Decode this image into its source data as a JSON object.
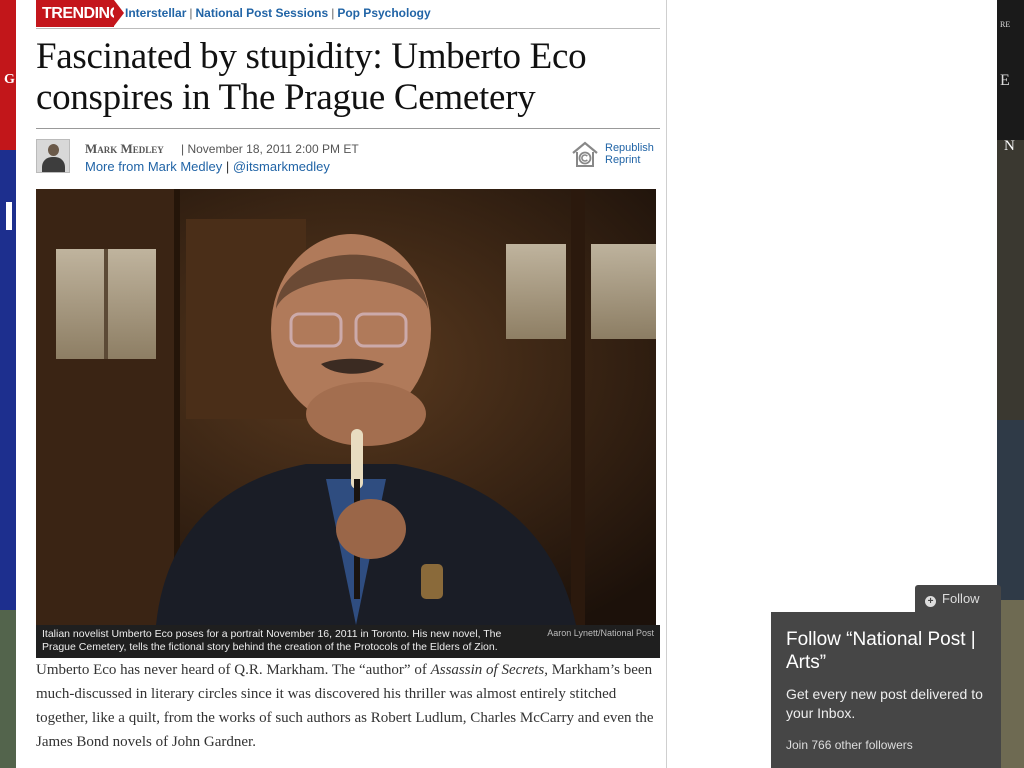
{
  "trending": {
    "label": "TRENDING",
    "links": [
      "Interstellar",
      "National Post Sessions",
      "Pop Psychology"
    ],
    "separator": "|"
  },
  "article": {
    "headline": "Fascinated by stupidity: Umberto Eco conspires in The Prague Cemetery",
    "author": "Mark Medley",
    "date": "November 18, 2011 2:00 PM ET",
    "more_from": "More from Mark Medley",
    "twitter": "@itsmarkmedley",
    "republish": "Republish",
    "reprint": "Reprint",
    "caption": "Italian novelist Umberto Eco poses for a portrait November 16, 2011 in Toronto. His new novel, The Prague Cemetery, tells the fictional story behind the creation of the Protocols of the Elders of Zion.",
    "photo_credit": "Aaron Lynett/National Post",
    "body_part1": "Umberto Eco has never heard of Q.R. Markham. The “author” of ",
    "body_italic": "Assassin of Secrets",
    "body_part2": ", Markham’s been much-discussed in literary circles since it was discovered his thriller was almost entirely stitched together, like a quilt, from the works of such authors as Robert Ludlum, Charles McCarry and even the James Bond novels of John Gardner."
  },
  "follow": {
    "tab_label": "Follow",
    "title": "Follow “National Post | Arts”",
    "description": "Get every new post delivered to your Inbox.",
    "followers": "Join 766 other followers"
  },
  "background": {
    "left_letter": "G",
    "right_small": "RE",
    "right_big": "E",
    "right_mid": "N"
  },
  "colors": {
    "accent_red": "#c4161c",
    "link_blue": "#2164a6",
    "widget_gray": "#464646"
  },
  "icons": {
    "republish": "republish-house-copyright-icon",
    "follow": "plus-circle-icon"
  }
}
